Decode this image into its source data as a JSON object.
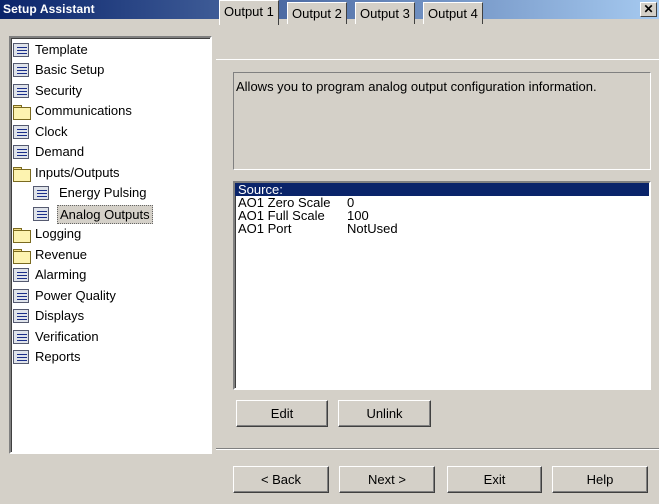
{
  "window": {
    "title": "Setup Assistant",
    "close_glyph": "✕"
  },
  "tree": {
    "items": [
      {
        "label": "Template",
        "icon": "doc-icon"
      },
      {
        "label": "Basic Setup",
        "icon": "doc-icon"
      },
      {
        "label": "Security",
        "icon": "doc-icon"
      },
      {
        "label": "Communications",
        "icon": "folder-icon"
      },
      {
        "label": "Clock",
        "icon": "doc-icon"
      },
      {
        "label": "Demand",
        "icon": "doc-icon"
      },
      {
        "label": "Inputs/Outputs",
        "icon": "folder-icon"
      },
      {
        "label": "Energy Pulsing",
        "icon": "doc-icon"
      },
      {
        "label": "Analog Outputs",
        "icon": "doc-icon",
        "selected": true
      },
      {
        "label": "Logging",
        "icon": "folder-icon"
      },
      {
        "label": "Revenue",
        "icon": "folder-icon"
      },
      {
        "label": "Alarming",
        "icon": "doc-icon"
      },
      {
        "label": "Power Quality",
        "icon": "doc-icon"
      },
      {
        "label": "Displays",
        "icon": "doc-icon"
      },
      {
        "label": "Verification",
        "icon": "doc-icon"
      },
      {
        "label": "Reports",
        "icon": "doc-icon"
      }
    ]
  },
  "tabs": [
    {
      "label": "Output 1",
      "active": true
    },
    {
      "label": "Output 2"
    },
    {
      "label": "Output 3"
    },
    {
      "label": "Output 4"
    }
  ],
  "description": "Allows you to program analog output configuration information.",
  "list": {
    "rows": [
      {
        "name": "Source:",
        "value": "",
        "selected": true
      },
      {
        "name": "AO1 Zero Scale",
        "value": "0"
      },
      {
        "name": "AO1 Full Scale",
        "value": "100"
      },
      {
        "name": "AO1 Port",
        "value": "NotUsed"
      }
    ]
  },
  "buttons": {
    "edit": "Edit",
    "unlink": "Unlink",
    "back": "< Back",
    "next": "Next >",
    "exit": "Exit",
    "help": "Help"
  },
  "colors": {
    "title_start": "#0a246a",
    "title_end": "#a6caf0",
    "selection": "#0a246a",
    "face": "#d4d0c8"
  }
}
